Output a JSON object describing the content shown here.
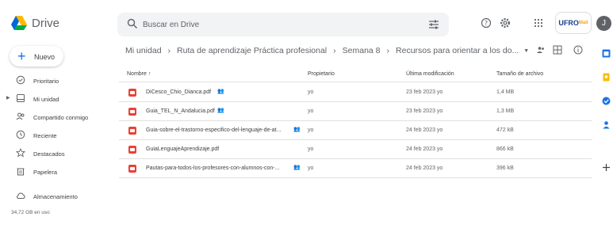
{
  "app": {
    "name": "Drive"
  },
  "search": {
    "placeholder": "Buscar en Drive"
  },
  "header": {
    "org_badge": "UFRO",
    "org_badge_sub": "Mail",
    "avatar_initial": "J"
  },
  "sidebar": {
    "new_label": "Nuevo",
    "items": [
      {
        "label": "Prioritario",
        "icon": "check-circle-icon"
      },
      {
        "label": "Mi unidad",
        "icon": "drive-icon"
      },
      {
        "label": "Compartido conmigo",
        "icon": "people-icon"
      },
      {
        "label": "Reciente",
        "icon": "clock-icon"
      },
      {
        "label": "Destacados",
        "icon": "star-icon"
      },
      {
        "label": "Papelera",
        "icon": "trash-icon"
      },
      {
        "label": "Almacenamiento",
        "icon": "cloud-icon"
      }
    ],
    "storage_text": "34,72 GB en uso"
  },
  "breadcrumb": [
    "Mi unidad",
    "Ruta de aprendizaje Práctica profesional",
    "Semana 8",
    "Recursos para orientar a los do..."
  ],
  "table": {
    "headers": {
      "name": "Nombre",
      "owner": "Propietario",
      "modified": "Última modificación",
      "size": "Tamaño de archivo"
    },
    "rows": [
      {
        "name": "DiCesco_Chio_Dianca.pdf",
        "owner": "yo",
        "modified": "23 feb 2023 yo",
        "size": "1,4 MB"
      },
      {
        "name": "Guia_TEL_N_Andalucia.pdf",
        "owner": "yo",
        "modified": "23 feb 2023 yo",
        "size": "1,3 MB"
      },
      {
        "name": "Guia-sobre-el-trastorno-especifico-del-lenguaje-de-at...",
        "owner": "yo",
        "modified": "24 feb 2023 yo",
        "size": "472 kB"
      },
      {
        "name": "GuiaLenguajeAprendizaje.pdf",
        "owner": "yo",
        "modified": "24 feb 2023 yo",
        "size": "866 kB"
      },
      {
        "name": "Pautas-para-todos-los-profesores-con-alumnos-con-...",
        "owner": "yo",
        "modified": "24 feb 2023 yo",
        "size": "396 kB"
      }
    ]
  },
  "colors": {
    "accent": "#1a73e8",
    "pdf": "#e94235",
    "text": "#3c4043",
    "muted": "#5f6368"
  }
}
